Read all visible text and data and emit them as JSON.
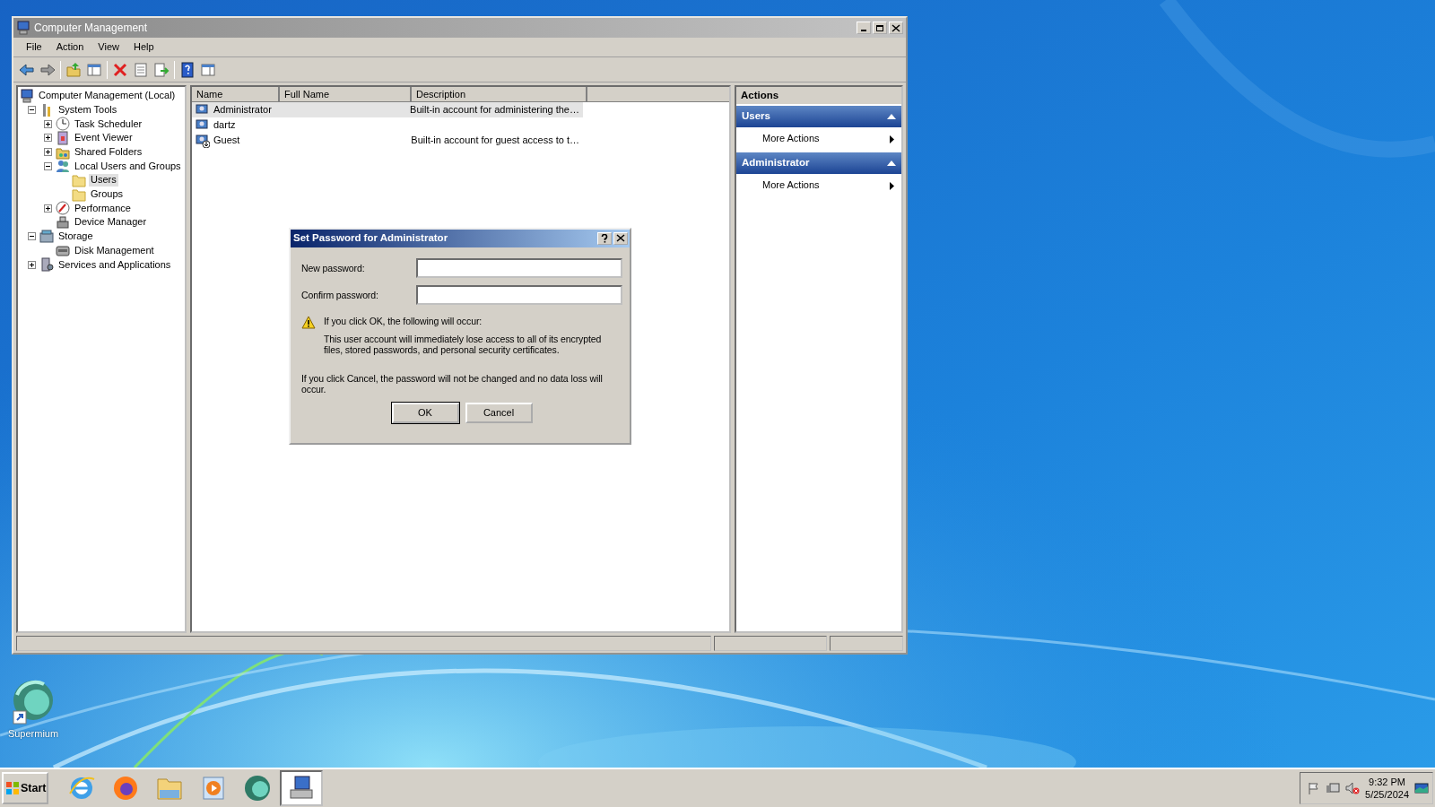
{
  "window": {
    "title": "Computer Management",
    "menu": [
      "File",
      "Action",
      "View",
      "Help"
    ],
    "tree": [
      {
        "label": "Computer Management (Local)",
        "selected": false,
        "children": [
          {
            "label": "System Tools",
            "expanded": true,
            "selected": false,
            "children": [
              {
                "label": "Task Scheduler",
                "expanded": false,
                "selected": false
              },
              {
                "label": "Event Viewer",
                "expanded": false,
                "selected": false
              },
              {
                "label": "Shared Folders",
                "expanded": false,
                "selected": false
              },
              {
                "label": "Local Users and Groups",
                "expanded": true,
                "selected": false,
                "children": [
                  {
                    "label": "Users",
                    "selected": true
                  },
                  {
                    "label": "Groups",
                    "selected": false
                  }
                ]
              },
              {
                "label": "Performance",
                "expanded": false,
                "selected": false
              },
              {
                "label": "Device Manager",
                "selected": false
              }
            ]
          },
          {
            "label": "Storage",
            "expanded": true,
            "selected": false,
            "children": [
              {
                "label": "Disk Management",
                "selected": false
              }
            ]
          },
          {
            "label": "Services and Applications",
            "expanded": false,
            "selected": false
          }
        ]
      }
    ],
    "list": {
      "columns": [
        "Name",
        "Full Name",
        "Description"
      ],
      "rows": [
        {
          "name": "Administrator",
          "description": "Built-in account for administering the…",
          "selected": true,
          "disabled": false
        },
        {
          "name": "dartz",
          "selected": false,
          "disabled": false
        },
        {
          "name": "Guest",
          "description": "Built-in account for guest access to t…",
          "selected": false,
          "disabled": true
        }
      ]
    },
    "actions": {
      "title": "Actions",
      "sections": [
        {
          "title": "Users",
          "expanded": true,
          "items": [
            "More Actions"
          ]
        },
        {
          "title": "Administrator",
          "expanded": true,
          "items": [
            "More Actions"
          ]
        }
      ]
    }
  },
  "dialog": {
    "title": "Set Password for Administrator",
    "fields": [
      {
        "label": "New password:"
      },
      {
        "label": "Confirm password:"
      }
    ],
    "warning_title": "If you click OK, the following will occur:",
    "warning_body": "This user account will immediately lose access to all of its encrypted files, stored passwords, and personal security certificates.",
    "cancel_note": "If you click Cancel, the password will not be changed and no data loss will occur.",
    "buttons": [
      {
        "label": "OK",
        "default": true
      },
      {
        "label": "Cancel",
        "default": false
      }
    ]
  },
  "desktop_icons": [
    {
      "label": "Supermium"
    }
  ],
  "taskbar": {
    "start": "Start",
    "apps": [
      {
        "selected": false
      },
      {
        "selected": false
      },
      {
        "selected": false
      },
      {
        "selected": false
      },
      {
        "selected": false
      },
      {
        "selected": true
      }
    ],
    "time": "9:32 PM",
    "date": "5/25/2024"
  }
}
